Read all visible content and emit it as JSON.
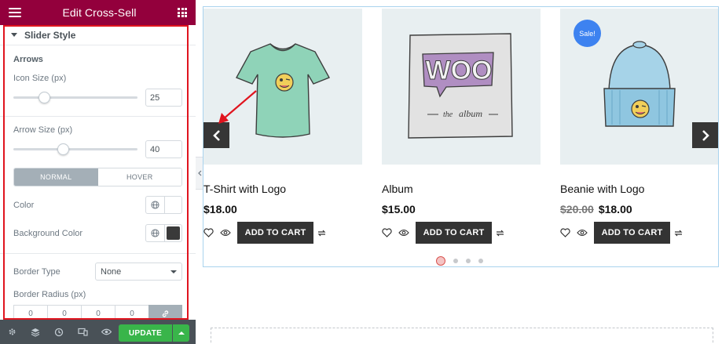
{
  "panel": {
    "title": "Edit Cross-Sell",
    "section_title": "Slider Style",
    "arrows_heading": "Arrows",
    "icon_size_label": "Icon Size (px)",
    "icon_size_value": "25",
    "icon_size_fraction": 0.25,
    "arrow_size_label": "Arrow Size (px)",
    "arrow_size_value": "40",
    "arrow_size_fraction": 0.4,
    "tabs": {
      "normal": "NORMAL",
      "hover": "HOVER"
    },
    "color_label": "Color",
    "bg_color_label": "Background Color",
    "bg_color_value": "#3a3a3a",
    "border_type_label": "Border Type",
    "border_type_value": "None",
    "border_radius_label": "Border Radius (px)",
    "border_radius_values": [
      "0",
      "0",
      "0",
      "0"
    ],
    "header_color": "#93003c",
    "highlight_color": "#e0141e"
  },
  "footer": {
    "update_label": "UPDATE",
    "update_color": "#39b54a",
    "icons": [
      "settings-icon",
      "layers-icon",
      "history-icon",
      "responsive-icon",
      "preview-eye-icon"
    ]
  },
  "products": [
    {
      "title": "T-Shirt with Logo",
      "price": "$18.00",
      "old_price": "",
      "sale": "",
      "button": "ADD TO CART"
    },
    {
      "title": "Album",
      "price": "$15.00",
      "old_price": "",
      "sale": "",
      "button": "ADD TO CART"
    },
    {
      "title": "Beanie with Logo",
      "price": "$18.00",
      "old_price": "$20.00",
      "sale": "Sale!",
      "button": "ADD TO CART"
    }
  ],
  "carousel": {
    "pages": 4,
    "active_page": 1,
    "border_color": "#a9d3ee"
  }
}
